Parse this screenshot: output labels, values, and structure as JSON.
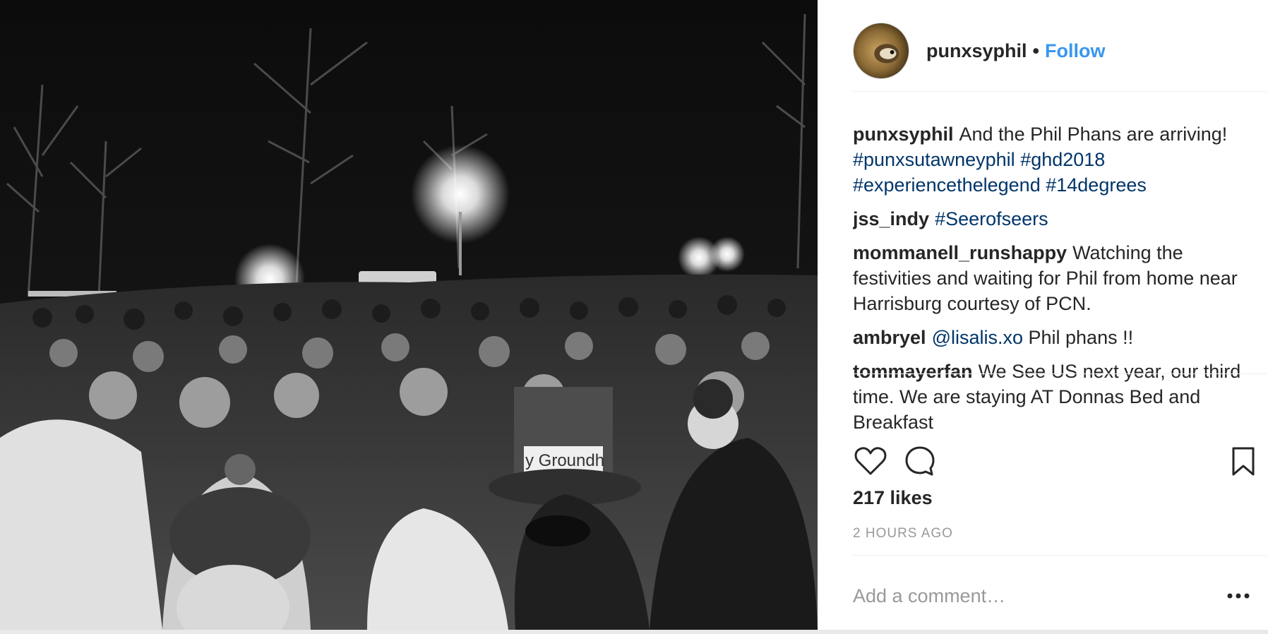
{
  "post": {
    "username": "punxsyphil",
    "separator": "•",
    "follow_label": "Follow"
  },
  "comments": [
    {
      "user": "punxsyphil",
      "parts": [
        {
          "text": "And the Phil Phans are arriving! ",
          "tag": false
        },
        {
          "text": "#punxsutawneyphil",
          "tag": true
        },
        {
          "text": " ",
          "tag": false
        },
        {
          "text": "#ghd2018",
          "tag": true
        },
        {
          "text": " ",
          "tag": false
        },
        {
          "text": "#experiencethelegend",
          "tag": true
        },
        {
          "text": " ",
          "tag": false
        },
        {
          "text": "#14degrees",
          "tag": true
        }
      ]
    },
    {
      "user": "jss_indy",
      "parts": [
        {
          "text": "#Seerofseers",
          "tag": true
        }
      ]
    },
    {
      "user": "mommanell_runshappy",
      "parts": [
        {
          "text": "Watching the festivities and waiting for Phil from home near Harrisburg courtesy of PCN.",
          "tag": false
        }
      ]
    },
    {
      "user": "ambryel",
      "parts": [
        {
          "text": "@lisalis.xo",
          "tag": true
        },
        {
          "text": " Phil phans !!",
          "tag": false
        }
      ]
    },
    {
      "user": "tommayerfan",
      "parts": [
        {
          "text": "We See US next year, our third time. We are staying AT Donnas Bed and Breakfast",
          "tag": false
        }
      ]
    }
  ],
  "icons": {
    "like": "heart-icon",
    "comment": "speech-bubble-icon",
    "save": "bookmark-icon",
    "more": "more-dots-icon"
  },
  "likes_label": "217 likes",
  "timestamp": "2 HOURS AGO",
  "add_comment": {
    "placeholder": "Add a comment…",
    "value": ""
  },
  "photo": {
    "hat_text": "y Groundh"
  },
  "colors": {
    "link": "#3897f0",
    "hashtag": "#003569",
    "muted": "#999999"
  }
}
